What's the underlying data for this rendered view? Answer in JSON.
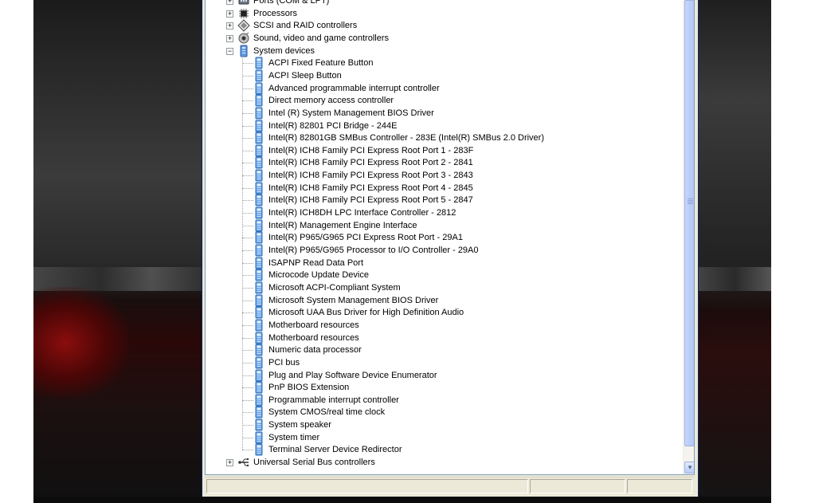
{
  "tree": {
    "categories_top": [
      {
        "label": "Ports (COM & LPT)",
        "icon": "port-icon",
        "expander": "+"
      },
      {
        "label": "Processors",
        "icon": "processor-icon",
        "expander": "+"
      },
      {
        "label": "SCSI and RAID controllers",
        "icon": "scsi-icon",
        "expander": "+"
      },
      {
        "label": "Sound, video and game controllers",
        "icon": "sound-icon",
        "expander": "+"
      },
      {
        "label": "System devices",
        "icon": "system-device-icon",
        "expander": "-"
      }
    ],
    "system_devices": [
      "ACPI Fixed Feature Button",
      "ACPI Sleep Button",
      "Advanced programmable interrupt controller",
      "Direct memory access controller",
      "Intel (R) System Management BIOS Driver",
      "Intel(R) 82801 PCI Bridge - 244E",
      "Intel(R) 82801GB SMBus Controller - 283E (Intel(R) SMBus 2.0 Driver)",
      "Intel(R) ICH8 Family PCI Express Root Port 1 - 283F",
      "Intel(R) ICH8 Family PCI Express Root Port 2 - 2841",
      "Intel(R) ICH8 Family PCI Express Root Port 3 - 2843",
      "Intel(R) ICH8 Family PCI Express Root Port 4 - 2845",
      "Intel(R) ICH8 Family PCI Express Root Port 5 - 2847",
      "Intel(R) ICH8DH LPC Interface Controller - 2812",
      "Intel(R) Management Engine Interface",
      "Intel(R) P965/G965 PCI Express Root Port - 29A1",
      "Intel(R) P965/G965 Processor to I/O Controller - 29A0",
      "ISAPNP Read Data Port",
      "Microcode Update Device",
      "Microsoft ACPI-Compliant System",
      "Microsoft System Management BIOS Driver",
      "Microsoft UAA Bus Driver for High Definition Audio",
      "Motherboard resources",
      "Motherboard resources",
      "Numeric data processor",
      "PCI bus",
      "Plug and Play Software Device Enumerator",
      "PnP BIOS Extension",
      "Programmable interrupt controller",
      "System CMOS/real time clock",
      "System speaker",
      "System timer",
      "Terminal Server Device Redirector"
    ],
    "categories_bottom": [
      {
        "label": "Universal Serial Bus controllers",
        "icon": "usb-icon",
        "expander": "+"
      }
    ]
  },
  "scrollbar": {
    "down_arrow": "▾"
  },
  "statusbar": {
    "panes": [
      "",
      "",
      ""
    ]
  }
}
